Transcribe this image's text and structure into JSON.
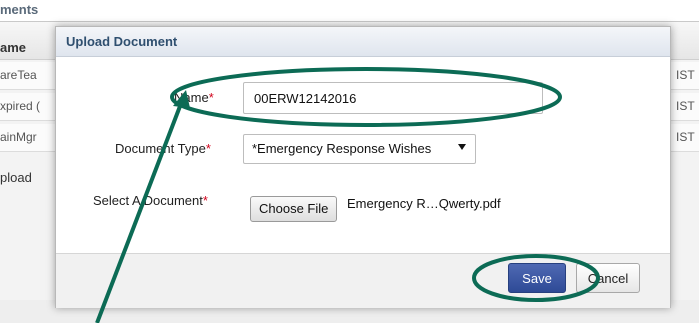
{
  "background": {
    "section_title": "ments",
    "column_name": "ame",
    "rows": [
      "areTea",
      "xpired (",
      "ainMgr"
    ],
    "right_cells": [
      "IST",
      "IST",
      "IST"
    ],
    "upload_link": "pload"
  },
  "modal": {
    "title": "Upload Document",
    "fields": {
      "name": {
        "label": "Name",
        "required_mark": "*",
        "value": "00ERW12142016"
      },
      "document_type": {
        "label": "Document Type",
        "required_mark": "*",
        "selected": "*Emergency Response Wishes"
      },
      "select_document": {
        "label": "Select A Document",
        "required_mark": "*",
        "button_label": "Choose File",
        "file_name": "Emergency R…Qwerty.pdf"
      }
    },
    "buttons": {
      "save": "Save",
      "cancel": "Cancel"
    }
  },
  "annotations": {
    "color": "#0c6b55"
  }
}
